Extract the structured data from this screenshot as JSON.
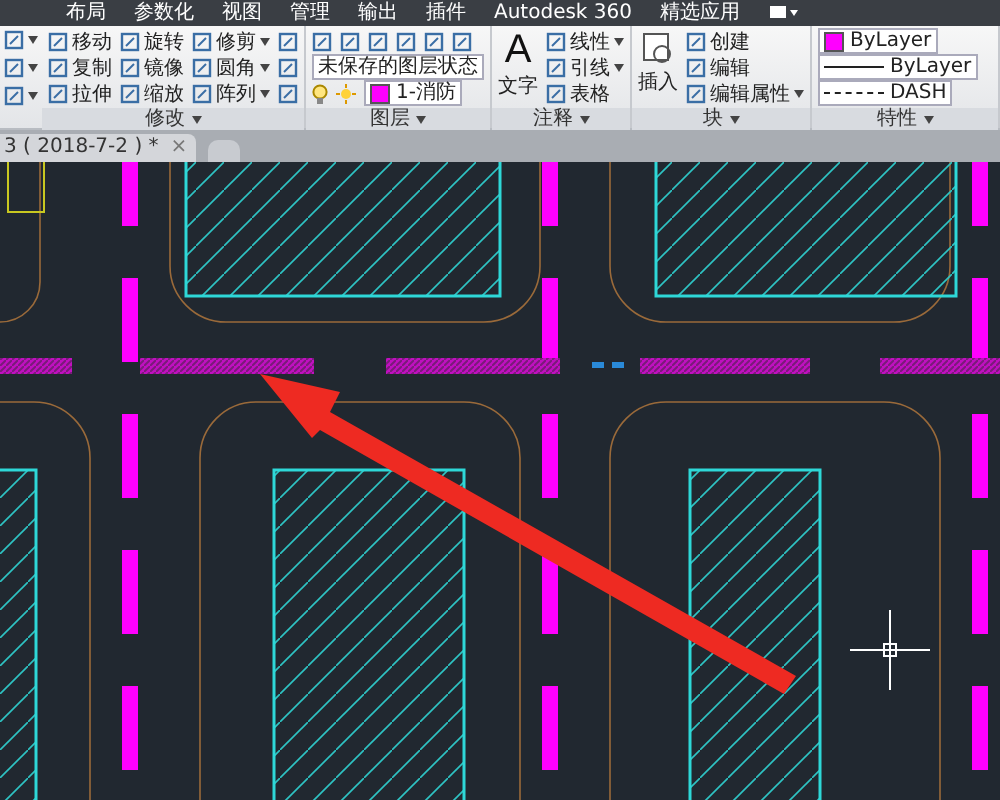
{
  "menu": [
    {
      "label": "布局"
    },
    {
      "label": "参数化"
    },
    {
      "label": "视图"
    },
    {
      "label": "管理"
    },
    {
      "label": "输出"
    },
    {
      "label": "插件"
    },
    {
      "label": "Autodesk 360"
    },
    {
      "label": "精选应用"
    }
  ],
  "ribbon": {
    "panels": [
      {
        "kind": "tools",
        "title": "修改",
        "rows": [
          [
            {
              "label": "移动",
              "dropdown": false
            },
            {
              "label": "旋转",
              "dropdown": false
            },
            {
              "label": "修剪",
              "dropdown": true
            }
          ],
          [
            {
              "label": "复制",
              "dropdown": false
            },
            {
              "label": "镜像",
              "dropdown": false
            },
            {
              "label": "圆角",
              "dropdown": true
            }
          ],
          [
            {
              "label": "拉伸",
              "dropdown": false
            },
            {
              "label": "缩放",
              "dropdown": false
            },
            {
              "label": "阵列",
              "dropdown": true
            }
          ]
        ]
      },
      {
        "kind": "layer",
        "title": "图层",
        "state": "未保存的图层状态",
        "layer": {
          "name": "1-消防",
          "color": "#ff00ff"
        }
      },
      {
        "kind": "tools",
        "title": "注释",
        "big": {
          "glyph": "A",
          "label": "文字"
        },
        "rows": [
          [
            {
              "label": "线性",
              "dropdown": true
            }
          ],
          [
            {
              "label": "引线",
              "dropdown": true
            }
          ],
          [
            {
              "label": "表格",
              "dropdown": false
            }
          ]
        ]
      },
      {
        "kind": "tools",
        "title": "块",
        "big": {
          "label": "插入"
        },
        "rows": [
          [
            {
              "label": "创建",
              "dropdown": false
            }
          ],
          [
            {
              "label": "编辑",
              "dropdown": false
            }
          ],
          [
            {
              "label": "编辑属性",
              "dropdown": true
            }
          ]
        ]
      },
      {
        "kind": "properties",
        "title": "特性",
        "color": {
          "name": "ByLayer",
          "color": "#ff00ff"
        },
        "lineweight": "ByLayer",
        "linetype": "DASH"
      }
    ]
  },
  "file_tab": {
    "label": "3 ( 2018-7-2 ) *",
    "close": "×"
  }
}
